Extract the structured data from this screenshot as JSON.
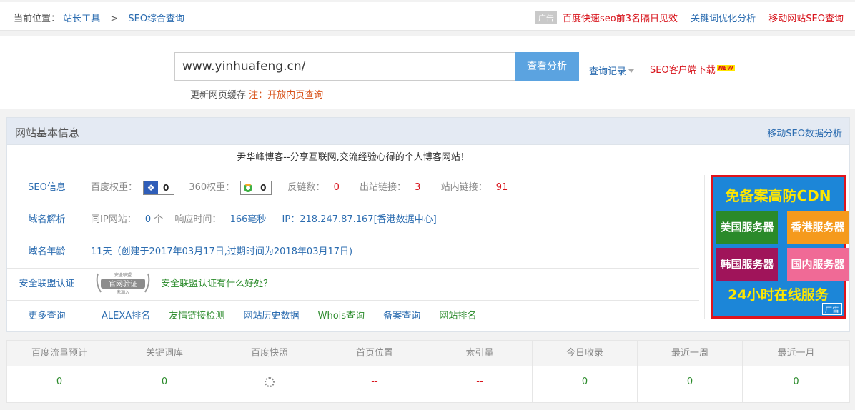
{
  "breadcrumb": {
    "prefix": "当前位置：",
    "items": [
      "站长工具",
      "SEO综合查询"
    ],
    "separator": ">"
  },
  "top_ads": {
    "ad_tag": "广告",
    "link1": "百度快速seo前3名隔日见效",
    "link2": "关键词优化分析",
    "link3": "移动网站SEO查询"
  },
  "search": {
    "value": "www.yinhuafeng.cn/",
    "button": "查看分析",
    "history": "查询记录",
    "download": "SEO客户端下载",
    "new_tag": "NEW",
    "cache_label": "更新网页缓存",
    "cache_note": "注：开放内页查询"
  },
  "panel": {
    "title": "网站基本信息",
    "more": "移动SEO数据分析",
    "description": "尹华峰博客--分享互联网,交流经验心得的个人博客网站！",
    "seo": {
      "label": "SEO信息",
      "baidu_weight_label": "百度权重：",
      "baidu_weight": "0",
      "w360_label": "360权重：",
      "w360": "0",
      "backlinks_label": "反链数：",
      "backlinks": "0",
      "outlinks_label": "出站链接：",
      "outlinks": "3",
      "inlinks_label": "站内链接：",
      "inlinks": "91"
    },
    "domain": {
      "label": "域名解析",
      "sameip_label": "同IP网站：",
      "sameip": "0",
      "sameip_unit": "个",
      "response_label": "响应时间：",
      "response": "166毫秒",
      "ip": "IP：218.247.87.167[香港数据中心]"
    },
    "age": {
      "label": "域名年龄",
      "value": "11天（创建于2017年03月17日,过期时间为2018年03月17日)"
    },
    "security": {
      "label": "安全联盟认证",
      "seal_top": "安全联盟",
      "seal_main": "官网验证",
      "seal_sub": "未加入",
      "link": "安全联盟认证有什么好处？"
    },
    "more_query": {
      "label": "更多查询",
      "links": [
        "ALEXA排名",
        "友情链接检测",
        "网站历史数据",
        "Whois查询",
        "备案查询",
        "网站排名"
      ]
    }
  },
  "ad_block": {
    "title": "免备案高防CDN",
    "tiles": [
      "美国服务器",
      "香港服务器",
      "韩国服务器",
      "国内服务器"
    ],
    "footer": "24小时在线服务",
    "tag": "广告",
    "colors": {
      "bg": "#1c86d8",
      "border": "#e0141c",
      "accent": "#ffe600"
    }
  },
  "stats": {
    "headers": [
      "百度流量预计",
      "关键词库",
      "百度快照",
      "首页位置",
      "索引量",
      "今日收录",
      "最近一周",
      "最近一月"
    ],
    "values": [
      "0",
      "0",
      "",
      "--",
      "--",
      "0",
      "0",
      "0"
    ]
  }
}
